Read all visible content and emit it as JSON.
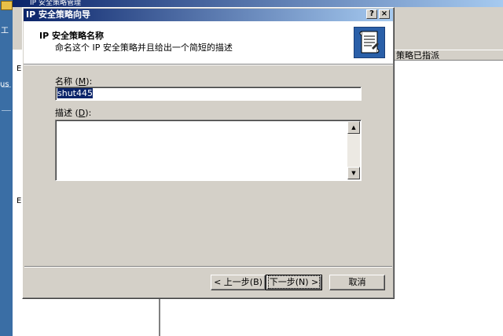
{
  "background": {
    "window_title": "IP 安全策略管理",
    "column_header": "策略已指派",
    "edge_glyphs": [
      "工",
      "E",
      "E",
      "us"
    ]
  },
  "dialog": {
    "title": "IP 安全策略向导",
    "help_btn": "?",
    "close_btn": "×",
    "header_title": "IP 安全策略名称",
    "header_subtitle": "命名这个 IP 安全策略并且给出一个简短的描述",
    "name_label": "名称",
    "name_hotkey": "M",
    "name_value": "shut445",
    "desc_label": "描述",
    "desc_hotkey": "D",
    "desc_value": "",
    "buttons": {
      "back": "< 上一步(B)",
      "next": "下一步(N) >",
      "cancel": "取消"
    }
  },
  "colors": {
    "titlebar_start": "#0a246a",
    "titlebar_end": "#a6caf0",
    "face": "#d4d0c8",
    "desktop": "#3a6ea5"
  },
  "icons": [
    "scroll-document-icon",
    "folder-icon",
    "scroll-up-icon",
    "scroll-down-icon"
  ]
}
